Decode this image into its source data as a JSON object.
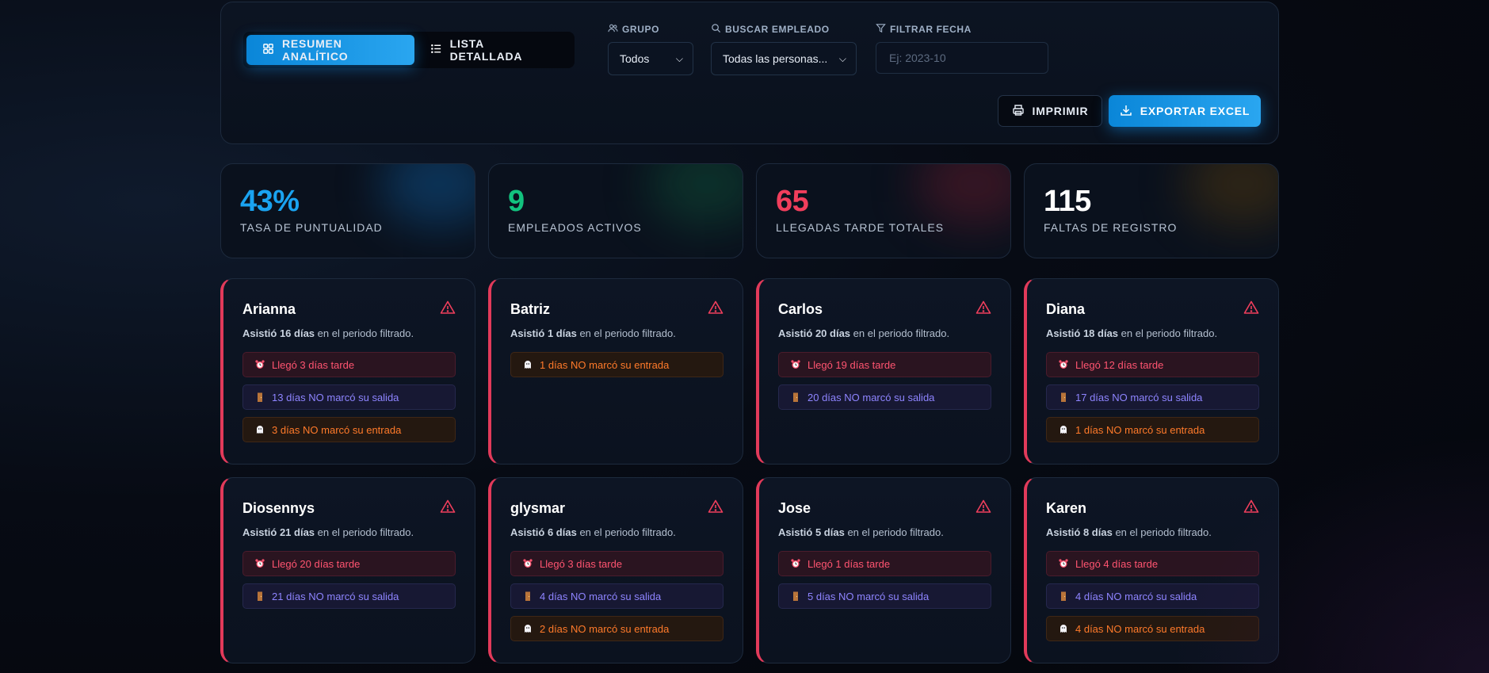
{
  "view_tabs": [
    {
      "label": "Resumen Analítico",
      "icon": "grid-icon",
      "active": true
    },
    {
      "label": "Lista Detallada",
      "icon": "list-icon",
      "active": false
    }
  ],
  "filters": {
    "group": {
      "label": "Grupo",
      "icon": "users-icon",
      "value": "Todos"
    },
    "employee": {
      "label": "Buscar Empleado",
      "icon": "search-icon",
      "value": "Todas las personas..."
    },
    "date": {
      "label": "Filtrar Fecha",
      "icon": "filter-icon",
      "placeholder": "Ej: 2023-10"
    }
  },
  "actions": {
    "print": {
      "label": "Imprimir",
      "icon": "printer-icon"
    },
    "export": {
      "label": "Exportar Excel",
      "icon": "download-icon"
    }
  },
  "stats": [
    {
      "value": "43%",
      "label": "Tasa de Puntualidad",
      "color": "#1aa3f0"
    },
    {
      "value": "9",
      "label": "Empleados Activos",
      "color": "#12c27e"
    },
    {
      "value": "65",
      "label": "Llegadas Tarde Totales",
      "color": "#f03e5c"
    },
    {
      "value": "115",
      "label": "Faltas de Registro",
      "color": "#ffffff"
    }
  ],
  "attend_suffix": "en el periodo filtrado.",
  "employees": [
    {
      "name": "Arianna",
      "attended": "Asistió 16 días",
      "issues": [
        {
          "type": "late",
          "text": "Llegó 3 días tarde"
        },
        {
          "type": "out",
          "text": "13 días NO marcó su salida"
        },
        {
          "type": "in",
          "text": "3 días NO marcó su entrada"
        }
      ]
    },
    {
      "name": "Batriz",
      "attended": "Asistió 1 días",
      "issues": [
        {
          "type": "in",
          "text": "1 días NO marcó su entrada"
        }
      ]
    },
    {
      "name": "Carlos",
      "attended": "Asistió 20 días",
      "issues": [
        {
          "type": "late",
          "text": "Llegó 19 días tarde"
        },
        {
          "type": "out",
          "text": "20 días NO marcó su salida"
        }
      ]
    },
    {
      "name": "Diana",
      "attended": "Asistió 18 días",
      "issues": [
        {
          "type": "late",
          "text": "Llegó 12 días tarde"
        },
        {
          "type": "out",
          "text": "17 días NO marcó su salida"
        },
        {
          "type": "in",
          "text": "1 días NO marcó su entrada"
        }
      ]
    },
    {
      "name": "Diosennys",
      "attended": "Asistió 21 días",
      "issues": [
        {
          "type": "late",
          "text": "Llegó 20 días tarde"
        },
        {
          "type": "out",
          "text": "21 días NO marcó su salida"
        }
      ]
    },
    {
      "name": "glysmar",
      "attended": "Asistió 6 días",
      "issues": [
        {
          "type": "late",
          "text": "Llegó 3 días tarde"
        },
        {
          "type": "out",
          "text": "4 días NO marcó su salida"
        },
        {
          "type": "in",
          "text": "2 días NO marcó su entrada"
        }
      ]
    },
    {
      "name": "Jose",
      "attended": "Asistió 5 días",
      "issues": [
        {
          "type": "late",
          "text": "Llegó 1 días tarde"
        },
        {
          "type": "out",
          "text": "5 días NO marcó su salida"
        }
      ]
    },
    {
      "name": "Karen",
      "attended": "Asistió 8 días",
      "issues": [
        {
          "type": "late",
          "text": "Llegó 4 días tarde"
        },
        {
          "type": "out",
          "text": "4 días NO marcó su salida"
        },
        {
          "type": "in",
          "text": "4 días NO marcó su entrada"
        }
      ]
    }
  ],
  "issue_icons": {
    "late": "alarm-clock-icon",
    "out": "door-icon",
    "in": "ghost-icon"
  }
}
